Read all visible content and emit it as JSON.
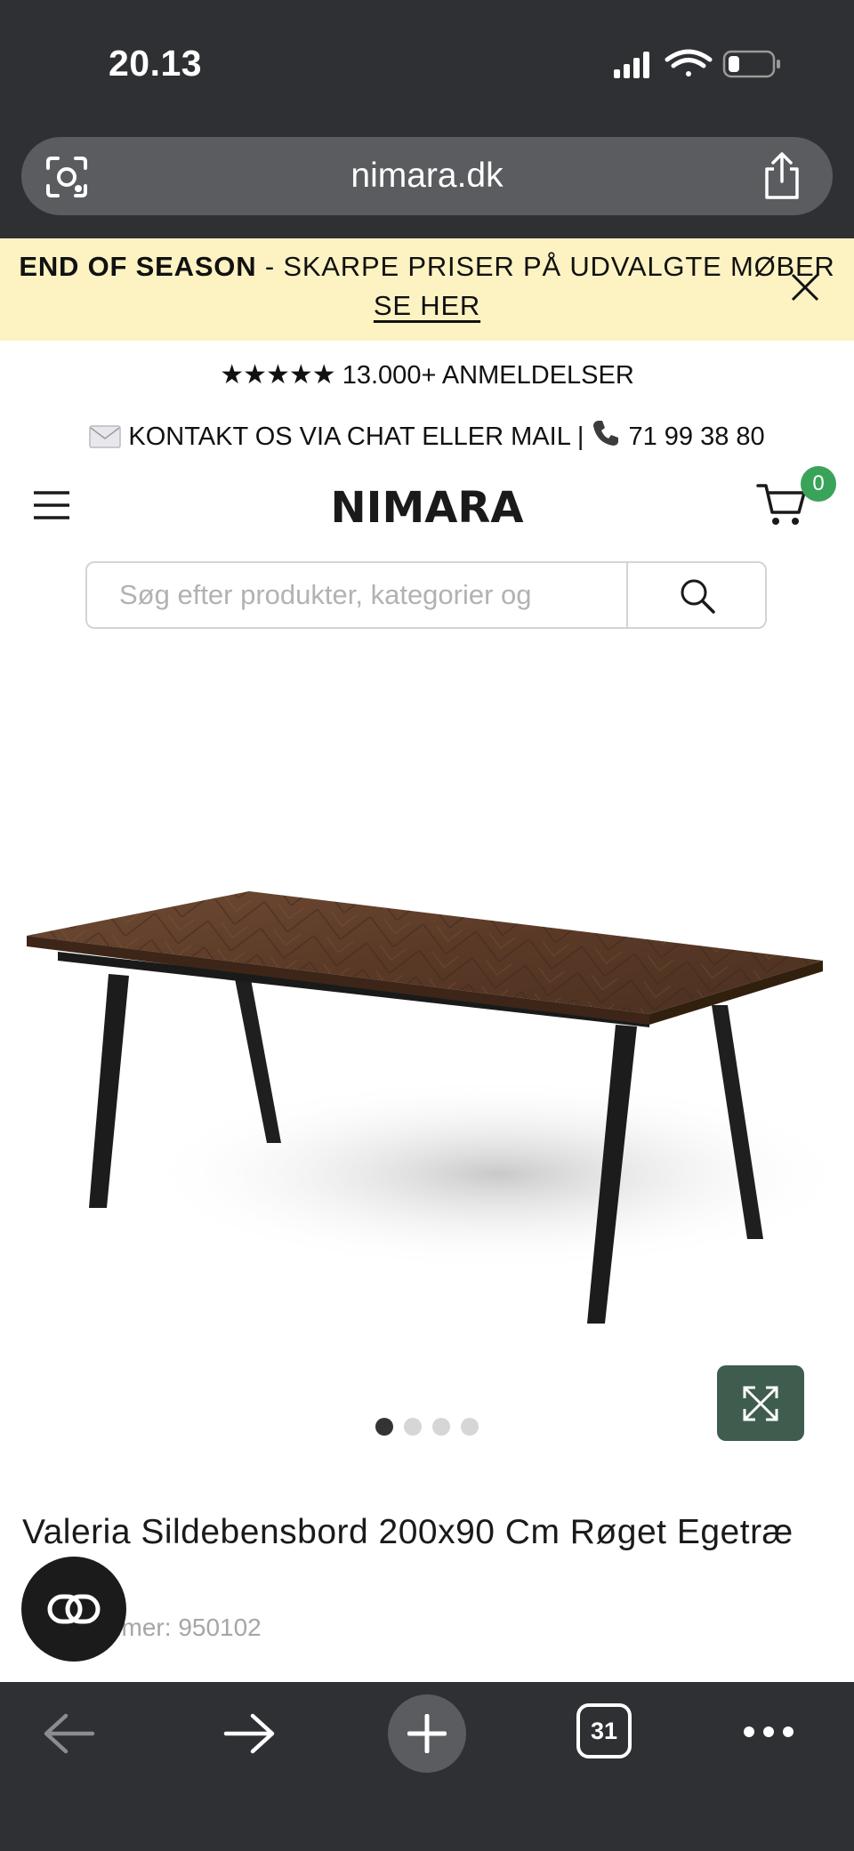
{
  "status_bar": {
    "time": "20.13"
  },
  "browser": {
    "url": "nimara.dk",
    "tab_count": "31"
  },
  "promo": {
    "bold": "END OF SEASON",
    "text": " - SKARPE PRISER PÅ UDVALGTE MØBER",
    "link": "SE HER"
  },
  "trust": {
    "stars": "★★★★★",
    "reviews": " 13.000+ ANMELDELSER",
    "contact": " KONTAKT OS VIA CHAT ELLER MAIL | ",
    "phone": " 71 99 38 80"
  },
  "header": {
    "logo": "NIMARA",
    "cart_count": "0"
  },
  "search": {
    "placeholder": "Søg efter produkter, kategorier og"
  },
  "gallery": {
    "image_count": 4,
    "active_index": 0
  },
  "product": {
    "title": "Valeria Sildebensbord 200x90 Cm Røget Egetræ",
    "sku": "Varenummer: 950102"
  },
  "colors": {
    "accent_green": "#3f5d4f",
    "badge_green": "#3aa35a",
    "promo_bg": "#fdf3c2",
    "chrome": "#2f3033"
  },
  "icons": [
    "lens-icon",
    "share-icon",
    "close-icon",
    "mail-icon",
    "phone-icon",
    "menu-icon",
    "cart-icon",
    "search-icon",
    "expand-icon",
    "chat-icon",
    "back-icon",
    "forward-icon",
    "plus-icon",
    "more-icon"
  ]
}
